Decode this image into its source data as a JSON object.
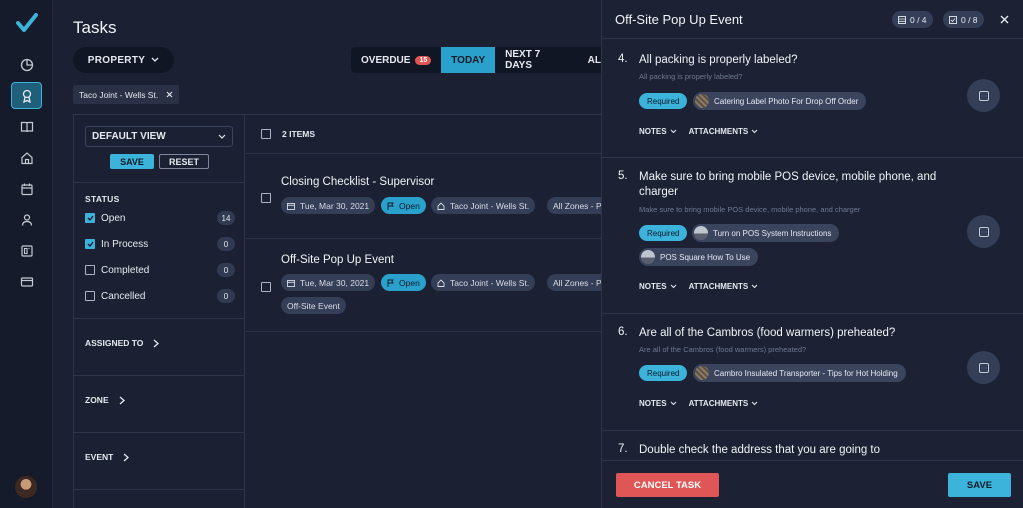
{
  "rail": {
    "items": [
      {
        "icon": "pie-chart-icon"
      },
      {
        "icon": "award-icon"
      },
      {
        "icon": "book-icon"
      },
      {
        "icon": "home-icon"
      },
      {
        "icon": "calendar-icon"
      },
      {
        "icon": "user-icon"
      },
      {
        "icon": "board-icon"
      },
      {
        "icon": "card-icon"
      }
    ],
    "accent": "#3bb3db"
  },
  "main": {
    "title": "Tasks",
    "property_button": "PROPERTY",
    "filter_chip": "Taco Joint - Wells St.",
    "tabs": [
      {
        "label": "OVERDUE",
        "badge": "15"
      },
      {
        "label": "TODAY"
      },
      {
        "label": "NEXT 7 DAYS"
      },
      {
        "label": "AL"
      }
    ]
  },
  "sidebar": {
    "view_select": "DEFAULT VIEW",
    "save": "SAVE",
    "reset": "RESET",
    "status_heading": "STATUS",
    "statuses": [
      {
        "label": "Open",
        "count": "14",
        "checked": true
      },
      {
        "label": "In Process",
        "count": "0",
        "checked": true
      },
      {
        "label": "Completed",
        "count": "0",
        "checked": false
      },
      {
        "label": "Cancelled",
        "count": "0",
        "checked": false
      }
    ],
    "facets": [
      "ASSIGNED TO",
      "ZONE",
      "EVENT"
    ]
  },
  "list": {
    "header": "2 ITEMS",
    "tasks": [
      {
        "name": "Closing Checklist - Supervisor",
        "date": "Tue, Mar 30, 2021",
        "status": "Open",
        "location": "Taco Joint - Wells St.",
        "zone": "All Zones - P"
      },
      {
        "name": "Off-Site Pop Up Event",
        "date": "Tue, Mar 30, 2021",
        "status": "Open",
        "location": "Taco Joint - Wells St.",
        "zone": "All Zones - P",
        "event": "Off-Site Event"
      }
    ]
  },
  "drawer": {
    "title": "Off-Site Pop Up Event",
    "count_a": "0 / 4",
    "count_b": "0 / 8",
    "questions": [
      {
        "num": "4.",
        "title": "All packing is properly labeled?",
        "subtitle": "All packing is properly labeled?",
        "required": "Required",
        "attachments": [
          "Catering Label Photo For Drop Off Order"
        ],
        "notes": "NOTES",
        "att_label": "ATTACHMENTS"
      },
      {
        "num": "5.",
        "title": "Make sure to bring mobile POS device, mobile phone, and charger",
        "subtitle": "Make sure to bring mobile POS device, mobile phone, and charger",
        "required": "Required",
        "attachments": [
          "Turn on POS System Instructions",
          "POS Square How To Use"
        ],
        "notes": "NOTES",
        "att_label": "ATTACHMENTS"
      },
      {
        "num": "6.",
        "title": "Are all of the Cambros (food warmers) preheated?",
        "subtitle": "Are all of the Cambros (food warmers) preheated?",
        "required": "Required",
        "attachments": [
          "Cambro Insulated Transporter - Tips for Hot Holding"
        ],
        "notes": "NOTES",
        "att_label": "ATTACHMENTS"
      },
      {
        "num": "7.",
        "title": "Double check the address that you are going to"
      }
    ],
    "cancel": "CANCEL TASK",
    "save": "SAVE"
  }
}
